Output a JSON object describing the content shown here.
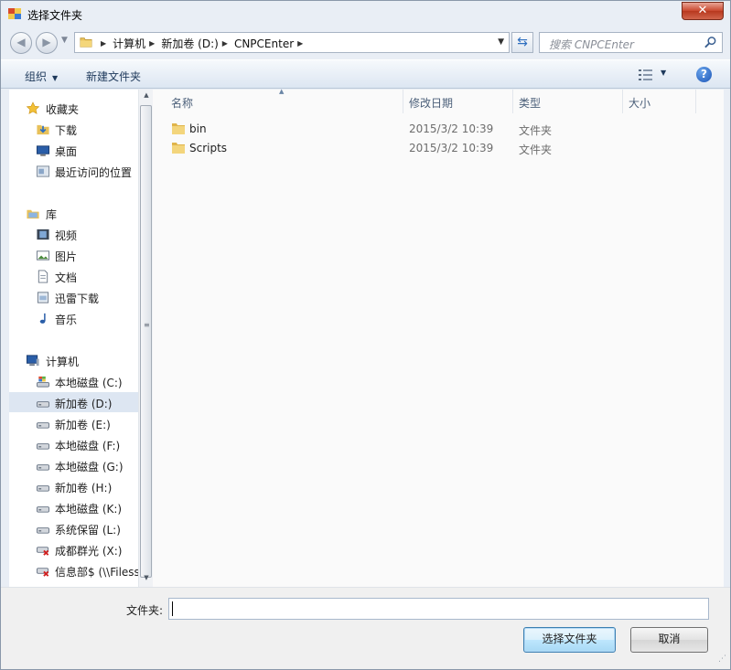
{
  "window": {
    "title": "选择文件夹",
    "close_label": "✕"
  },
  "address": {
    "crumbs": [
      "计算机",
      "新加卷 (D:)",
      "CNPCEnter"
    ]
  },
  "search": {
    "placeholder": "搜索 CNPCEnter"
  },
  "toolbar": {
    "organize_label": "组织",
    "new_folder_label": "新建文件夹",
    "help_label": "?"
  },
  "nav": {
    "favorites_header": "收藏夹",
    "favorites": [
      "下载",
      "桌面",
      "最近访问的位置"
    ],
    "libraries_header": "库",
    "libraries": [
      "视频",
      "图片",
      "文档",
      "迅雷下载",
      "音乐"
    ],
    "computer_header": "计算机",
    "drives": [
      "本地磁盘 (C:)",
      "新加卷 (D:)",
      "新加卷 (E:)",
      "本地磁盘 (F:)",
      "本地磁盘 (G:)",
      "新加卷 (H:)",
      "本地磁盘 (K:)",
      "系统保留 (L:)",
      "成都群光 (X:)",
      "信息部$ (\\\\Filess"
    ],
    "selected_drive": "新加卷 (D:)"
  },
  "columns": [
    "名称",
    "修改日期",
    "类型",
    "大小"
  ],
  "files": [
    {
      "name": "bin",
      "date": "2015/3/2 10:39",
      "type": "文件夹"
    },
    {
      "name": "Scripts",
      "date": "2015/3/2 10:39",
      "type": "文件夹"
    }
  ],
  "footer": {
    "folder_label": "文件夹:",
    "folder_value": "",
    "ok_label": "选择文件夹",
    "cancel_label": "取消"
  },
  "colors": {
    "accent": "#1e395b",
    "selection": "#dde6f2",
    "close": "#c9462c"
  }
}
